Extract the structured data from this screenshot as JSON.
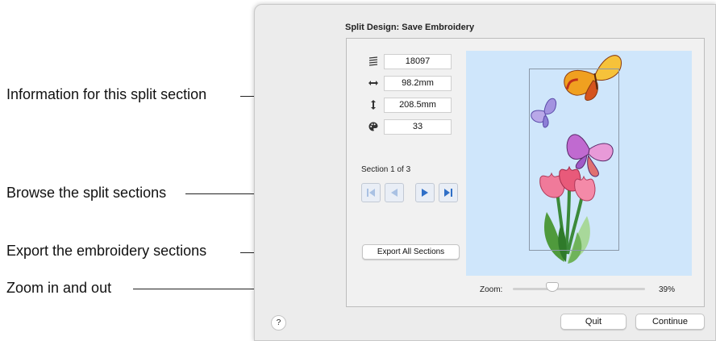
{
  "callouts": {
    "info": "Information for this split section",
    "browse": "Browse the split sections",
    "export": "Export the embroidery sections",
    "zoom": "Zoom in and out"
  },
  "dialog": {
    "title": "Split Design: Save Embroidery",
    "info": {
      "stitches": "18097",
      "width": "98.2mm",
      "height": "208.5mm",
      "colors": "33"
    },
    "icons": {
      "stitches": "stitch-count-icon",
      "width": "width-arrow-icon",
      "height": "height-arrow-icon",
      "colors": "palette-icon"
    },
    "section_label": "Section 1 of 3",
    "nav": {
      "first": "first-section",
      "previous": "previous-section",
      "next": "next-section",
      "last": "last-section"
    },
    "export_button": "Export All Sections",
    "zoom_label": "Zoom:",
    "zoom_value": "39%",
    "zoom_level": 0.25,
    "help_button": "?",
    "quit_button": "Quit",
    "continue_button": "Continue"
  },
  "colors": {
    "preview_background": "#cfe6fb",
    "nav_accent": "#2f6fc7"
  }
}
